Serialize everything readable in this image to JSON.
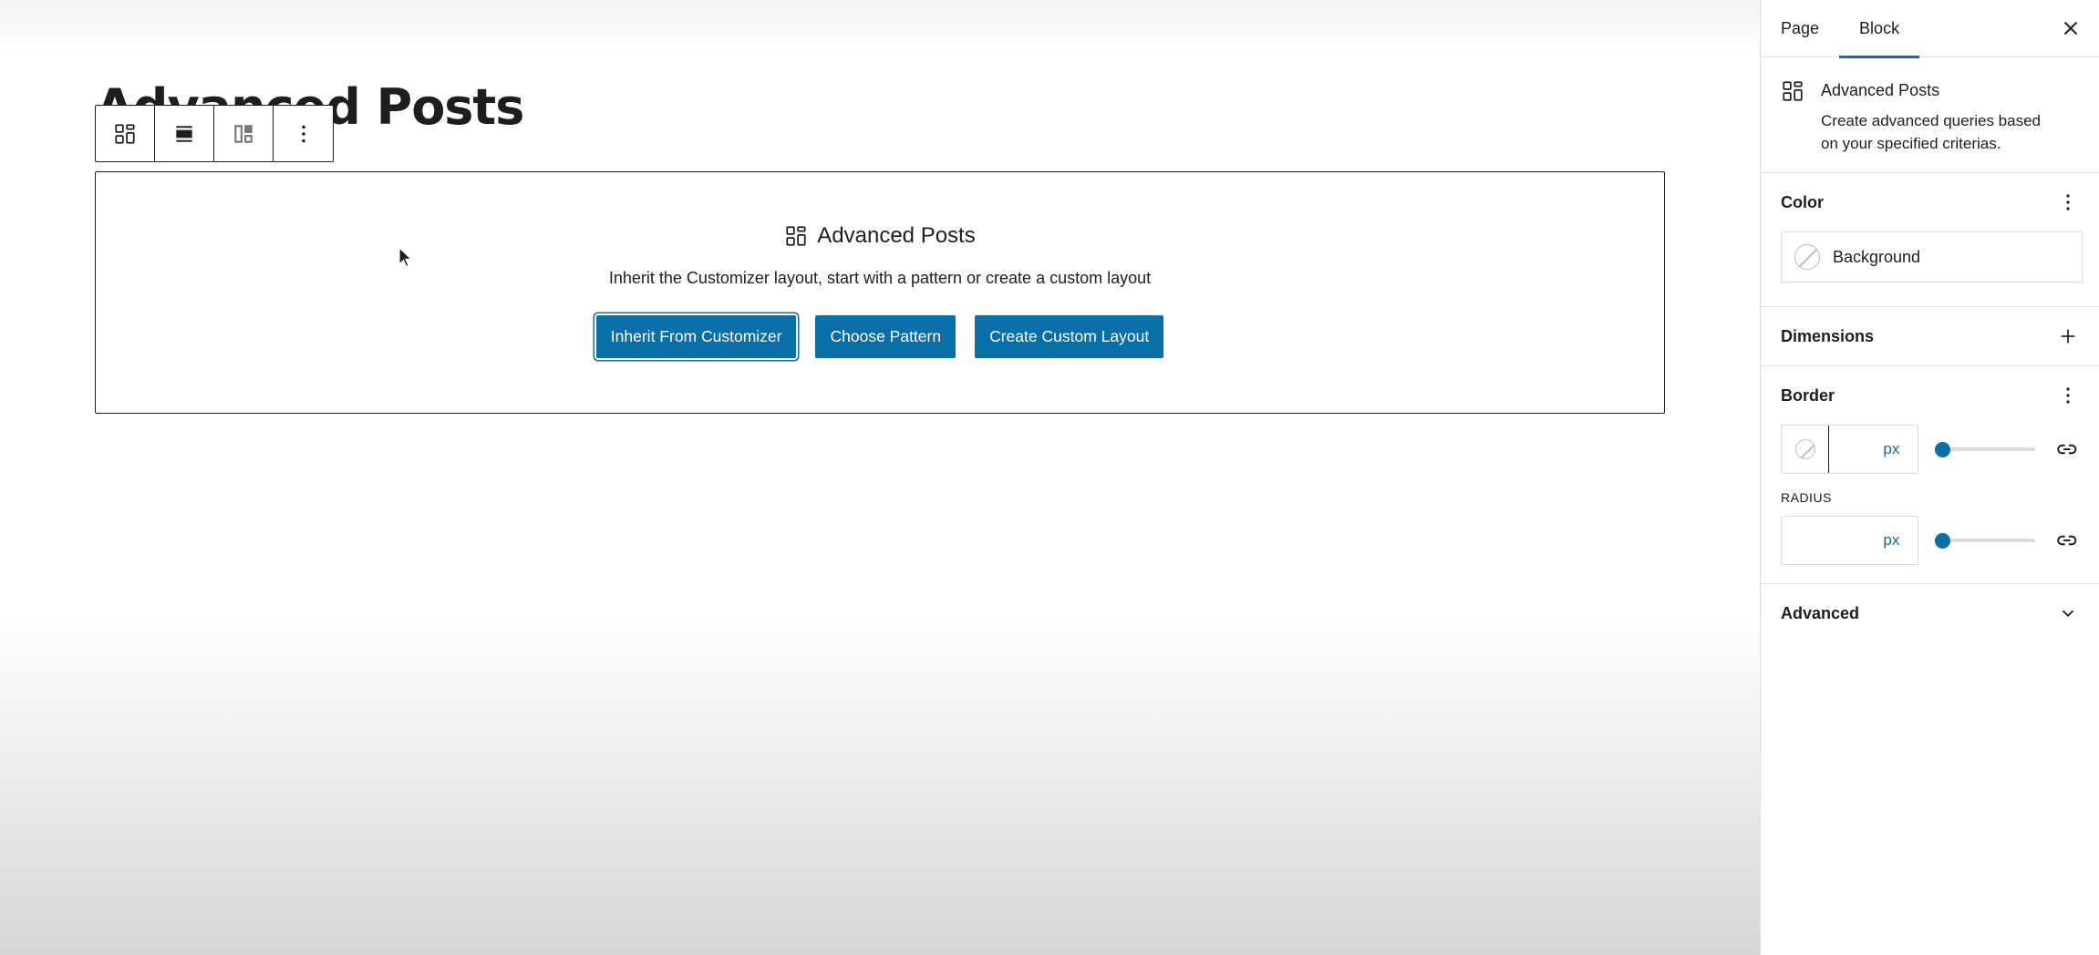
{
  "editor": {
    "page_title": "Advanced Posts",
    "toolbar": {
      "items": [
        {
          "icon": "advanced-posts-icon"
        },
        {
          "icon": "align-icon"
        },
        {
          "icon": "layout-icon"
        },
        {
          "icon": "more-options-icon"
        }
      ]
    },
    "block": {
      "title": "Advanced Posts",
      "description": "Inherit the Customizer layout, start with a pattern or create a custom layout",
      "buttons": {
        "inherit": "Inherit From Customizer",
        "pattern": "Choose Pattern",
        "custom": "Create Custom Layout"
      }
    }
  },
  "sidebar": {
    "tabs": {
      "page": "Page",
      "block": "Block"
    },
    "block_card": {
      "title": "Advanced Posts",
      "description": "Create advanced queries based on your specified criterias."
    },
    "color": {
      "title": "Color",
      "background_label": "Background"
    },
    "dimensions": {
      "title": "Dimensions"
    },
    "border": {
      "title": "Border",
      "width_unit": "px",
      "radius_label": "RADIUS",
      "radius_unit": "px",
      "width_slider_value": 0,
      "radius_slider_value": 0
    },
    "advanced": {
      "title": "Advanced"
    }
  },
  "colors": {
    "accent": "#0a6fa8",
    "border": "#1e1e1e",
    "divider": "#e0e0e0"
  }
}
